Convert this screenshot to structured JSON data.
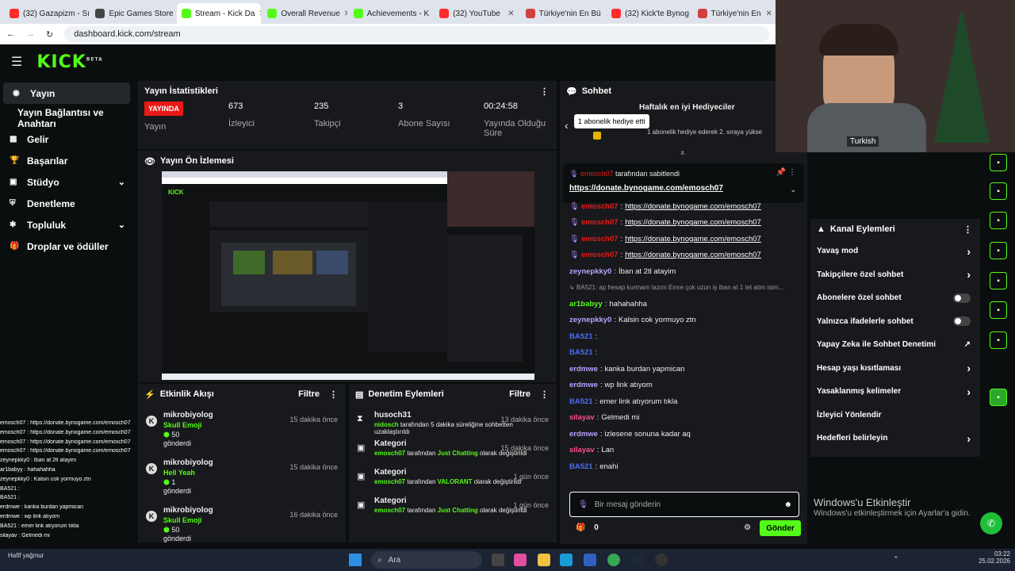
{
  "browser": {
    "tabs": [
      {
        "title": "(32) Gazapizm - Sı",
        "color": "#ff2b2b"
      },
      {
        "title": "Epic Games Store",
        "color": "#444"
      },
      {
        "title": "Stream - Kick Da",
        "color": "#53fc18",
        "active": true
      },
      {
        "title": "Overall Revenue",
        "color": "#53fc18"
      },
      {
        "title": "Achievements - K",
        "color": "#53fc18"
      },
      {
        "title": "(32) YouTube",
        "color": "#ff2b2b"
      },
      {
        "title": "Türkiye'nin En Bü",
        "color": "#d04040"
      },
      {
        "title": "(32) Kick'te Bynog",
        "color": "#ff2b2b"
      },
      {
        "title": "Türkiye'nin En",
        "color": "#d04040"
      }
    ],
    "url": "dashboard.kick.com/stream"
  },
  "logo": "KICK",
  "logo_badge": "BETA",
  "sidebar": {
    "items": [
      {
        "label": "Yayın",
        "icon": "broadcast-icon"
      },
      {
        "label": "Yayın Bağlantısı ve Anahtarı",
        "icon": ""
      },
      {
        "label": "Gelir",
        "icon": "revenue-icon"
      },
      {
        "label": "Başarılar",
        "icon": "trophy-icon"
      },
      {
        "label": "Stüdyo",
        "icon": "studio-icon",
        "chevron": true
      },
      {
        "label": "Denetleme",
        "icon": "shield-icon"
      },
      {
        "label": "Topluluk",
        "icon": "community-icon",
        "chevron": true
      },
      {
        "label": "Droplar ve ödüller",
        "icon": "gift-icon"
      }
    ]
  },
  "stats": {
    "title": "Yayın İstatistikleri",
    "live_badge": "YAYINDA",
    "live_label": "Yayın",
    "items": [
      {
        "value": "673",
        "label": "İzleyici"
      },
      {
        "value": "235",
        "label": "Takipçi"
      },
      {
        "value": "3",
        "label": "Abone Sayısı"
      },
      {
        "value": "00:24:58",
        "label": "Yayında Olduğu Süre"
      }
    ]
  },
  "preview": {
    "title": "Yayın Ön İzlemesi"
  },
  "activity": {
    "title": "Etkinlik Akışı",
    "filter": "Filtre",
    "items": [
      {
        "user": "mikrobiyolog",
        "item": "Skull Emoji",
        "amount": "50",
        "sent": "gönderdi",
        "time": "15 dakika önce"
      },
      {
        "user": "mikrobiyolog",
        "item": "Hell Yeah",
        "amount": "1",
        "sent": "gönderdi",
        "time": "15 dakika önce"
      },
      {
        "user": "mikrobiyolog",
        "item": "Skull Emoji",
        "amount": "50",
        "sent": "gönderdi",
        "time": "16 dakika önce"
      }
    ]
  },
  "moderation": {
    "title": "Denetim Eylemleri",
    "filter": "Filtre",
    "items": [
      {
        "title": "husoch31",
        "time": "13 dakika önce",
        "l1a": "nidosch",
        "l1b": " tarafından 5 dakika süreliğine sohbetten",
        "l2": "uzaklaştırıldı"
      },
      {
        "title": "Kategori",
        "time": "15 dakika önce",
        "l1a": "emosch07",
        "l1b": " tarafından ",
        "l1c": "Just Chatting",
        "l1d": " olarak değiştirildi"
      },
      {
        "title": "Kategori",
        "time": "1 gün önce",
        "l1a": "emosch07",
        "l1b": " tarafından ",
        "l1c": "VALORANT",
        "l1d": " olarak değiştirildi"
      },
      {
        "title": "Kategori",
        "time": "1 gün önce",
        "l1a": "emosch07",
        "l1b": " tarafından ",
        "l1c": "Just Chatting",
        "l1d": " olarak değiştirildi"
      }
    ]
  },
  "chat": {
    "title": "Sohbet",
    "top_gifters": "Haftalık en iyi Hediyeciler",
    "tooltip": "1 abonelik hediye etti",
    "gift_text": "1 abonelik hediye ederek 2. sıraya yükse",
    "pinned_by": "emosch07",
    "pinned_suffix": " tarafından sabitlendi",
    "pinned_link": "https://donate.bynogame.com/emosch07",
    "messages": [
      {
        "user": "emosch07",
        "cls": "red",
        "text": "https://donate.bynogame.com/emosch07",
        "link": true
      },
      {
        "user": "emosch07",
        "cls": "red",
        "text": "https://donate.bynogame.com/emosch07",
        "link": true
      },
      {
        "user": "emosch07",
        "cls": "red",
        "text": "https://donate.bynogame.com/emosch07",
        "link": true
      },
      {
        "user": "emosch07",
        "cls": "red",
        "text": "https://donate.bynogame.com/emosch07",
        "link": true
      },
      {
        "user": "zeynepkky0",
        "cls": "lav",
        "text": "İban at 2tl atayim"
      },
      {
        "user": "",
        "cls": "",
        "text": "↳ BA521: ap hesap kurmam lazım Emre çok uzun iş iban at 1 tel atim isim..."
      },
      {
        "user": "ar1babyy",
        "cls": "g",
        "text": "hahahahha"
      },
      {
        "user": "zeynepkky0",
        "cls": "lav",
        "text": "Kalsin cok yormuyo ztn"
      },
      {
        "user": "BA521",
        "cls": "blue",
        "text": ""
      },
      {
        "user": "BA521",
        "cls": "blue",
        "text": ""
      },
      {
        "user": "erdmwe",
        "cls": "lav",
        "text": "kanka burdan yapmican"
      },
      {
        "user": "erdmwe",
        "cls": "lav",
        "text": "wp link atıyom"
      },
      {
        "user": "BA521",
        "cls": "blue",
        "text": "emer link atıyorum tıkla"
      },
      {
        "user": "silayav",
        "cls": "pink",
        "text": "Gelmedi mi"
      },
      {
        "user": "erdmwe",
        "cls": "lav",
        "text": "izlesene sonuna kadar aq"
      },
      {
        "user": "silayav",
        "cls": "pink",
        "text": "Lan"
      },
      {
        "user": "BA521",
        "cls": "blue",
        "text": "enahi"
      }
    ],
    "placeholder": "Bir mesaj gönderin",
    "points": "0",
    "send": "Gönder"
  },
  "channel_actions": {
    "title": "Kanal Eylemleri",
    "items": [
      {
        "label": "Yavaş mod",
        "ctl": "chev"
      },
      {
        "label": "Takipçilere özel sohbet",
        "ctl": "chev"
      },
      {
        "label": "Abonelere özel sohbet",
        "ctl": "toggle"
      },
      {
        "label": "Yalnızca ifadelerle sohbet",
        "ctl": "toggle"
      },
      {
        "label": "Yapay Zeka ile Sohbet Denetimi",
        "ctl": "ext"
      },
      {
        "label": "Hesap yaşı kısıtlaması",
        "ctl": "chev"
      },
      {
        "label": "Yasaklanmış kelimeler",
        "ctl": "chev"
      },
      {
        "label": "İzleyici Yönlendir",
        "ctl": ""
      },
      {
        "label": "Hedefleri belirleyin",
        "ctl": "chev"
      }
    ]
  },
  "webcam_label": "Turkish",
  "windows": {
    "title": "Windows'u Etkinleştir",
    "subtitle": "Windows'u etkinleştirmek için Ayarlar'a gidin."
  },
  "taskbar": {
    "search": "Ara",
    "time": "03:22",
    "date": "25.02.2026",
    "weather": "Hafif yağmur"
  },
  "overlay_chat": [
    "emosch07 : https://donate.bynogame.com/emosch07",
    "emosch07 : https://donate.bynogame.com/emosch07",
    "emosch07 : https://donate.bynogame.com/emosch07",
    "emosch07 : https://donate.bynogame.com/emosch07",
    "zeynepkky0 : İban at 2tl atayim",
    "ar1babyy : hahahahha",
    "zeynepkky0 : Kalsin cok yormuyo ztn",
    "BA521 :",
    "BA521 :",
    "erdmwe : kanka burdan yapmican",
    "erdmwe : wp link atıyom",
    "BA521 : emer link atıyorum tıkla",
    "silayav : Gelmedi mi"
  ]
}
